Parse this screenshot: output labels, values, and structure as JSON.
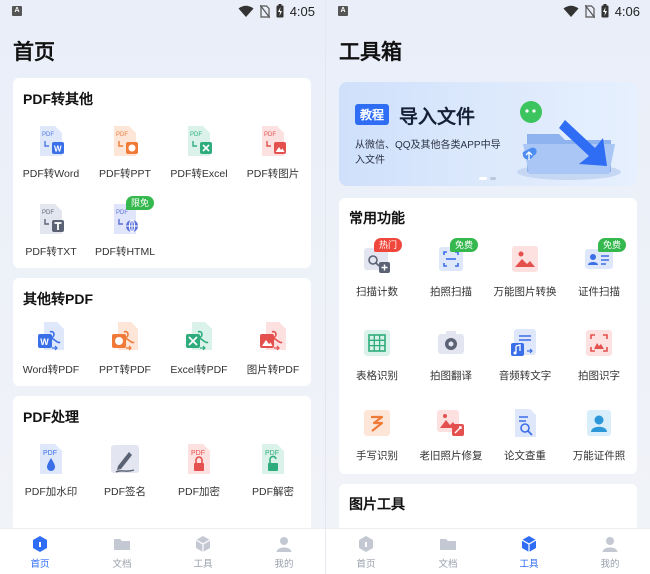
{
  "status_left": {
    "time": "4:05"
  },
  "status_right": {
    "time": "4:06"
  },
  "home": {
    "title": "首页",
    "pdf_to_other": {
      "title": "PDF转其他",
      "items": [
        {
          "label": "PDF转Word",
          "icon": "pdf-to-word-icon"
        },
        {
          "label": "PDF转PPT",
          "icon": "pdf-to-ppt-icon"
        },
        {
          "label": "PDF转Excel",
          "icon": "pdf-to-excel-icon"
        },
        {
          "label": "PDF转图片",
          "icon": "pdf-to-image-icon"
        },
        {
          "label": "PDF转TXT",
          "icon": "pdf-to-txt-icon"
        },
        {
          "label": "PDF转HTML",
          "icon": "pdf-to-html-icon",
          "badge": "限免"
        }
      ]
    },
    "other_to_pdf": {
      "title": "其他转PDF",
      "items": [
        {
          "label": "Word转PDF",
          "icon": "word-to-pdf-icon"
        },
        {
          "label": "PPT转PDF",
          "icon": "ppt-to-pdf-icon"
        },
        {
          "label": "Excel转PDF",
          "icon": "excel-to-pdf-icon"
        },
        {
          "label": "图片转PDF",
          "icon": "image-to-pdf-icon"
        }
      ]
    },
    "pdf_process": {
      "title": "PDF处理",
      "items": [
        {
          "label": "PDF加水印",
          "icon": "watermark-icon"
        },
        {
          "label": "PDF签名",
          "icon": "signature-icon"
        },
        {
          "label": "PDF加密",
          "icon": "encrypt-icon"
        },
        {
          "label": "PDF解密",
          "icon": "decrypt-icon"
        }
      ]
    }
  },
  "toolbox": {
    "title": "工具箱",
    "banner": {
      "tag": "教程",
      "title": "导入文件",
      "desc": "从微信、QQ及其他各类APP中导入文件"
    },
    "common": {
      "title": "常用功能",
      "items": [
        {
          "label": "扫描计数",
          "icon": "scan-count-icon",
          "badge": "热门"
        },
        {
          "label": "拍照扫描",
          "icon": "photo-scan-icon",
          "badge": "免费"
        },
        {
          "label": "万能图片转换",
          "icon": "image-convert-icon"
        },
        {
          "label": "证件扫描",
          "icon": "id-scan-icon",
          "badge": "免费"
        },
        {
          "label": "表格识别",
          "icon": "table-recognize-icon"
        },
        {
          "label": "拍图翻译",
          "icon": "photo-translate-icon"
        },
        {
          "label": "音频转文字",
          "icon": "audio-to-text-icon"
        },
        {
          "label": "拍图识字",
          "icon": "photo-ocr-icon"
        },
        {
          "label": "手写识别",
          "icon": "handwriting-icon"
        },
        {
          "label": "老旧照片修复",
          "icon": "photo-restore-icon"
        },
        {
          "label": "论文查重",
          "icon": "paper-check-icon"
        },
        {
          "label": "万能证件照",
          "icon": "id-photo-icon"
        }
      ]
    },
    "image_tools": {
      "title": "图片工具"
    }
  },
  "tabbar": {
    "items": [
      {
        "label": "首页"
      },
      {
        "label": "文档"
      },
      {
        "label": "工具"
      },
      {
        "label": "我的"
      }
    ]
  },
  "colors": {
    "accent": "#2f6df5",
    "tab_inactive": "#9aa1ad",
    "badge_green": "#35b84d",
    "badge_red": "#f0473c"
  }
}
